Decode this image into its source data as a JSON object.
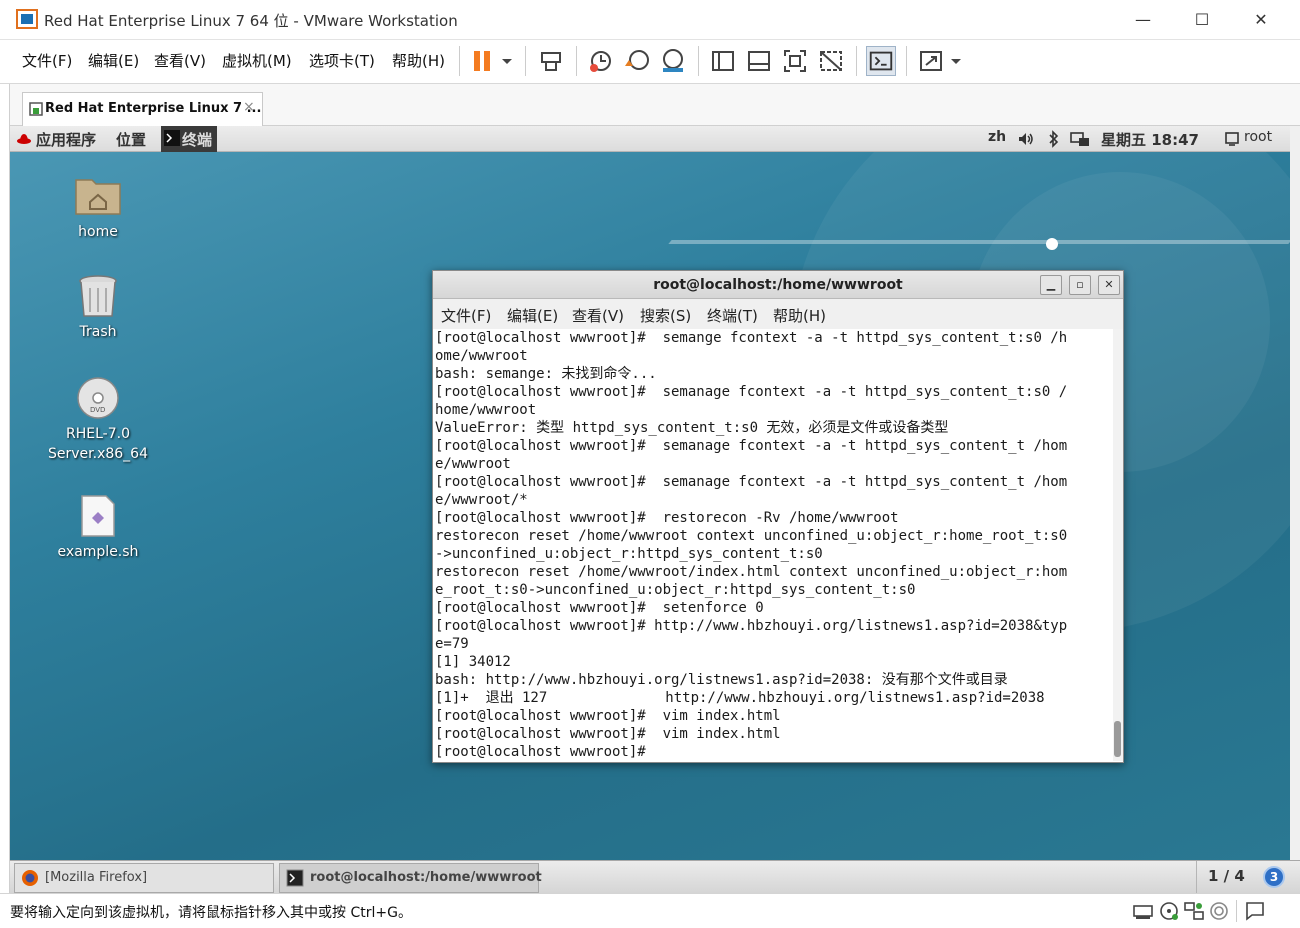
{
  "window": {
    "title": "Red Hat Enterprise Linux 7 64 位 - VMware Workstation",
    "minimize": "—",
    "maximize": "☐",
    "close": "✕"
  },
  "menu": [
    "文件(F)",
    "编辑(E)",
    "查看(V)",
    "虚拟机(M)",
    "选项卡(T)",
    "帮助(H)"
  ],
  "vm_tab": {
    "label": "Red Hat Enterprise Linux 7 ...",
    "close": "×"
  },
  "gnome_top": {
    "apps": "应用程序",
    "places": "位置",
    "terminal": "终端",
    "lang": "zh",
    "clock": "星期五 18:47",
    "user": "root"
  },
  "desktop_icons": [
    {
      "label": "home",
      "icon": "folder-home-icon"
    },
    {
      "label": "Trash",
      "icon": "trash-icon"
    },
    {
      "label": "RHEL-7.0 Server.x86_64",
      "icon": "dvd-icon"
    },
    {
      "label": "example.sh",
      "icon": "script-file-icon"
    }
  ],
  "terminal": {
    "title": "root@localhost:/home/wwwroot",
    "menu": [
      "文件(F)",
      "编辑(E)",
      "查看(V)",
      "搜索(S)",
      "终端(T)",
      "帮助(H)"
    ],
    "lines": [
      "[root@localhost wwwroot]#  semange fcontext -a -t httpd_sys_content_t:s0 /h",
      "ome/wwwroot",
      "bash: semange: 未找到命令...",
      "[root@localhost wwwroot]#  semanage fcontext -a -t httpd_sys_content_t:s0 /",
      "home/wwwroot",
      "ValueError: 类型 httpd_sys_content_t:s0 无效，必须是文件或设备类型",
      "[root@localhost wwwroot]#  semanage fcontext -a -t httpd_sys_content_t /hom",
      "e/wwwroot",
      "[root@localhost wwwroot]#  semanage fcontext -a -t httpd_sys_content_t /hom",
      "e/wwwroot/*",
      "[root@localhost wwwroot]#  restorecon -Rv /home/wwwroot",
      "restorecon reset /home/wwwroot context unconfined_u:object_r:home_root_t:s0",
      "->unconfined_u:object_r:httpd_sys_content_t:s0",
      "restorecon reset /home/wwwroot/index.html context unconfined_u:object_r:hom",
      "e_root_t:s0->unconfined_u:object_r:httpd_sys_content_t:s0",
      "[root@localhost wwwroot]#  setenforce 0",
      "[root@localhost wwwroot]# http://www.hbzhouyi.org/listnews1.asp?id=2038&typ",
      "e=79",
      "[1] 34012",
      "bash: http://www.hbzhouyi.org/listnews1.asp?id=2038: 没有那个文件或目录",
      "[1]+  退出 127              http://www.hbzhouyi.org/listnews1.asp?id=2038",
      "[root@localhost wwwroot]#  vim index.html",
      "[root@localhost wwwroot]#  vim index.html",
      "[root@localhost wwwroot]# "
    ]
  },
  "taskbar": {
    "firefox": "[Mozilla Firefox]",
    "terminal": "root@localhost:/home/wwwroot",
    "workspace": "1 / 4",
    "badge": "3"
  },
  "status": {
    "message": "要将输入定向到该虚拟机，请将鼠标指针移入其中或按 Ctrl+G。"
  },
  "colors": {
    "pause_orange": "#f47b20",
    "desktop_teal": "#2a6f89"
  }
}
